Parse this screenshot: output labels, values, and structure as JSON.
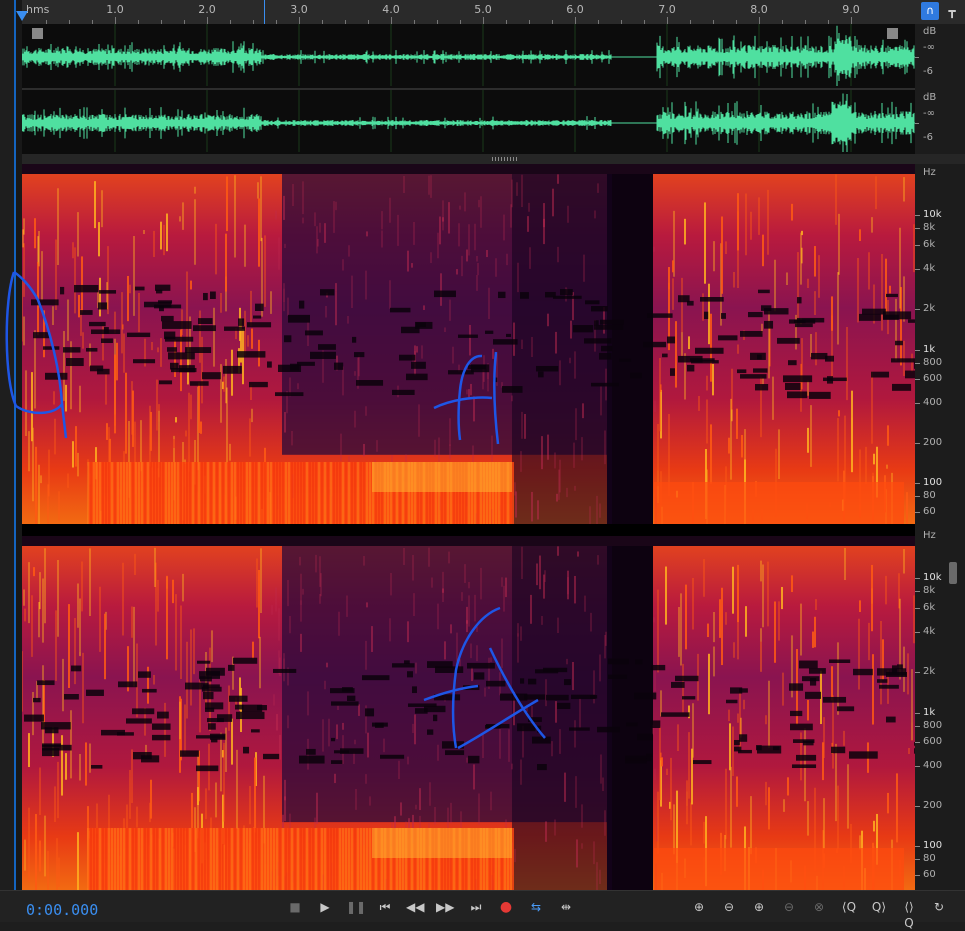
{
  "ruler": {
    "unit_label": "hms",
    "ticks": [
      "1.0",
      "2.0",
      "3.0",
      "4.0",
      "5.0",
      "6.0",
      "7.0",
      "8.0",
      "9.0"
    ]
  },
  "waveform_scale": {
    "unit": "dB",
    "top": "-∞",
    "bottom": "-6"
  },
  "frequency_scale": {
    "unit": "Hz",
    "labels": [
      "10k",
      "8k",
      "6k",
      "4k",
      "2k",
      "1k",
      "800",
      "600",
      "400",
      "200",
      "100",
      "80",
      "60"
    ]
  },
  "transport": {
    "time": "0:00.000",
    "buttons": [
      {
        "name": "stop-button",
        "icon": "stop-icon",
        "glyph": "■"
      },
      {
        "name": "play-button",
        "icon": "play-icon",
        "glyph": "▶"
      },
      {
        "name": "pause-button",
        "icon": "pause-icon",
        "glyph": "❚❚"
      },
      {
        "name": "move-to-previous-button",
        "icon": "skip-back-icon",
        "glyph": "⏮"
      },
      {
        "name": "rewind-button",
        "icon": "rewind-icon",
        "glyph": "◀◀"
      },
      {
        "name": "fast-forward-button",
        "icon": "fast-forward-icon",
        "glyph": "▶▶"
      },
      {
        "name": "move-to-next-button",
        "icon": "skip-forward-icon",
        "glyph": "⏭"
      },
      {
        "name": "record-button",
        "icon": "record-icon",
        "glyph": "●"
      },
      {
        "name": "loop-button",
        "icon": "loop-icon",
        "glyph": "⇆"
      },
      {
        "name": "skip-selection-button",
        "icon": "skip-selection-icon",
        "glyph": "⇹"
      }
    ]
  },
  "zoom": {
    "buttons": [
      {
        "name": "zoom-in-amplitude-button",
        "icon": "zoom-in-amplitude-icon",
        "glyph": "⊕"
      },
      {
        "name": "zoom-out-amplitude-button",
        "icon": "zoom-out-amplitude-icon",
        "glyph": "⊖"
      },
      {
        "name": "zoom-in-time-button",
        "icon": "zoom-in-time-icon",
        "glyph": "⊕"
      },
      {
        "name": "zoom-out-full-button",
        "icon": "zoom-out-full-icon",
        "glyph": "⊖"
      },
      {
        "name": "zoom-selection-button",
        "icon": "zoom-selection-icon",
        "glyph": "⊗"
      },
      {
        "name": "zoom-in-left-button",
        "icon": "zoom-in-left-icon",
        "glyph": "⟨Q"
      },
      {
        "name": "zoom-in-right-button",
        "icon": "zoom-in-right-icon",
        "glyph": "Q⟩"
      },
      {
        "name": "zoom-out-range-button",
        "icon": "zoom-out-range-icon",
        "glyph": "⟨⟩Q"
      },
      {
        "name": "zoom-reset-button",
        "icon": "zoom-reset-icon",
        "glyph": "↻"
      }
    ]
  },
  "colors": {
    "waveform": "#4fe0a0",
    "accent": "#3a8ef0",
    "annotation": "#1e56e6"
  }
}
